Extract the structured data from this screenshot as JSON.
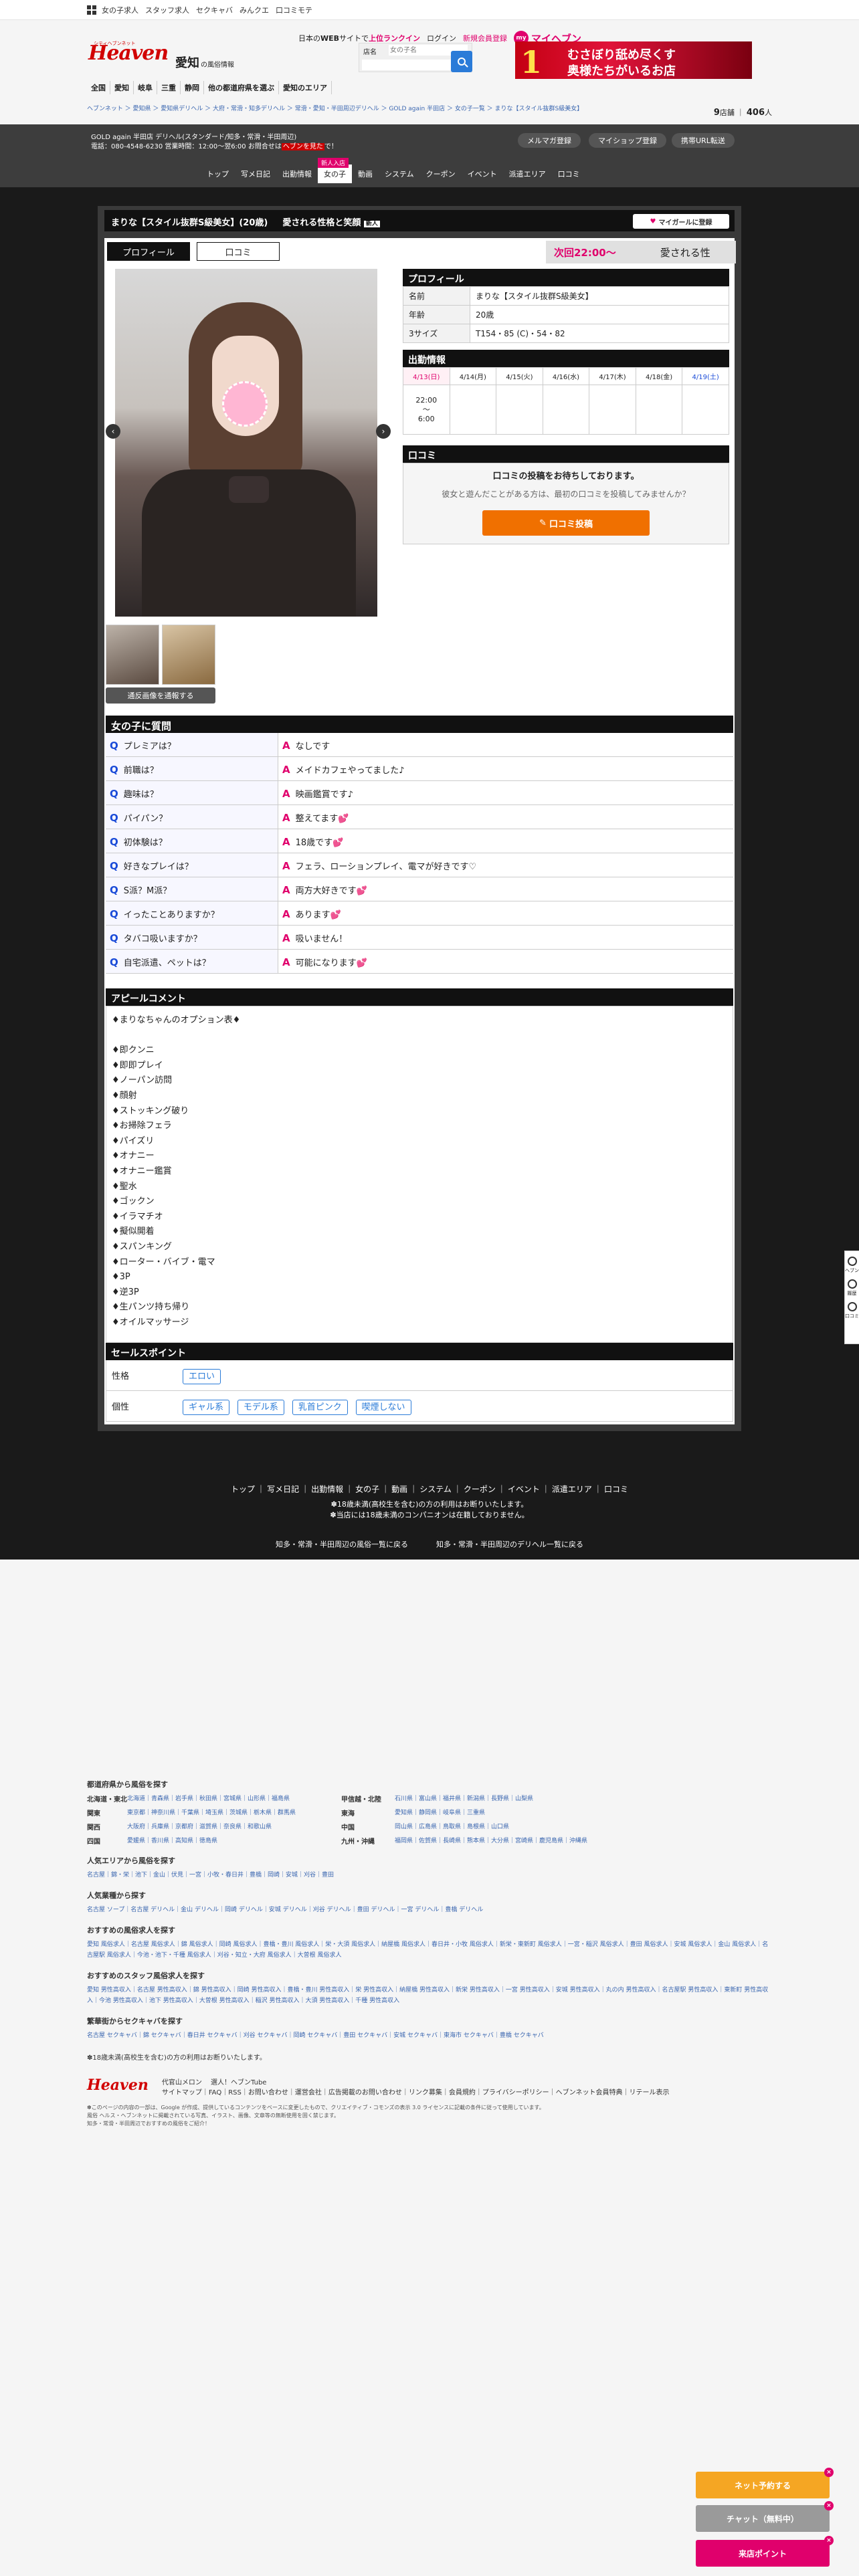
{
  "topbar": {
    "links": [
      "女の子求人",
      "スタッフ求人",
      "セクキャバ",
      "みんクエ",
      "口コミモテ"
    ],
    "right_pre": "日本の",
    "right_web": "WEB",
    "right_mid": "サイトで",
    "right_hl": "上位ランクイン",
    "login": "ログイン",
    "register": "新規会員登録",
    "my_badge": "my",
    "myheaven": "マイヘブン"
  },
  "header": {
    "logo_sub": "シティヘブンネット",
    "logo": "Heaven",
    "area": "愛知",
    "area_sub": "の風俗情報",
    "search_label": "店名",
    "search_placeholder": "女の子名",
    "banner_num": "1",
    "banner_l1": "むさぼり舐め尽くす",
    "banner_l2": "奥様たちがいるお店"
  },
  "nav": [
    "全国",
    "愛知",
    "岐阜",
    "三重",
    "静岡",
    "他の都道府県を選ぶ",
    "愛知のエリア"
  ],
  "breadcrumb": "ヘブンネット ＞ 愛知県 ＞ 愛知県デリヘル ＞ 大府・常滑・知多デリヘル ＞ 常滑・愛知・半田周辺デリヘル ＞ GOLD again 半田店 ＞ 女の子一覧 ＞ まりな【スタイル抜群S級美女】",
  "counts": {
    "a": "9",
    "a_unit": "店舗",
    "b": "406",
    "b_unit": "人"
  },
  "shop": {
    "name": "GOLD again 半田店 デリヘル(スタンダード/知多・常滑・半田周辺)",
    "tel": "電話：080-4548-6230 営業時間：12:00〜翌6:00 お問合せは",
    "tel_red": "ヘブンを見た",
    "tel_end": "で！",
    "btns": [
      "メルマガ登録",
      "マイショップ登録",
      "携帯URL転送"
    ],
    "tabs": [
      "トップ",
      "写メ日記",
      "出勤情報",
      "女の子",
      "動画",
      "システム",
      "クーポン",
      "イベント",
      "派遣エリア",
      "口コミ"
    ],
    "new_badge": "新人入店"
  },
  "girl": {
    "title": "まりな【スタイル抜群S級美女】(20歳)",
    "catch": "愛される性格と笑顔",
    "new": "新人",
    "mypage": "マイガールに登録",
    "tabs": [
      "プロフィール",
      "口コミ"
    ],
    "next_work": "次回22:00〜",
    "next_scroll": "愛される性"
  },
  "profile": {
    "heading": "プロフィール",
    "rows": [
      {
        "k": "名前",
        "v": "まりな【スタイル抜群S級美女】"
      },
      {
        "k": "年齢",
        "v": "20歳"
      },
      {
        "k": "3サイズ",
        "v": "T154・85 (C)・54・82"
      }
    ]
  },
  "schedule": {
    "heading": "出勤情報",
    "days": [
      "4/13(日)",
      "4/14(月)",
      "4/15(火)",
      "4/16(水)",
      "4/17(木)",
      "4/18(金)",
      "4/19(土)"
    ],
    "time_start": "22:00",
    "time_sep": "〜",
    "time_end": "6:00"
  },
  "review": {
    "heading": "口コミ",
    "t1": "口コミの投稿をお待ちしております。",
    "t2": "彼女と遊んだことがある方は、最初の口コミを投稿してみませんか？",
    "btn": "口コミ投稿"
  },
  "photo": {
    "swap": "通反画像を通報する",
    "prev": "‹",
    "next": "›"
  },
  "qa": {
    "heading": "女の子に質問",
    "q_mark": "Q",
    "a_mark": "A",
    "items": [
      {
        "q": "プレミアは？",
        "a": "なしです"
      },
      {
        "q": "前職は？",
        "a": "メイドカフェやってました♪"
      },
      {
        "q": "趣味は？",
        "a": "映画鑑賞です♪"
      },
      {
        "q": "パイパン？",
        "a": "整えてます💕"
      },
      {
        "q": "初体験は？",
        "a": "18歳です💕"
      },
      {
        "q": "好きなプレイは？",
        "a": "フェラ、ローションプレイ、電マが好きです♡"
      },
      {
        "q": "S派？M派？",
        "a": "両方大好きです💕"
      },
      {
        "q": "イったことありますか？",
        "a": "あります💕"
      },
      {
        "q": "タバコ吸いますか？",
        "a": "吸いません！"
      },
      {
        "q": "自宅派遣、ペットは？",
        "a": "可能になります💕"
      }
    ]
  },
  "appeal": {
    "heading": "アピールコメント",
    "lines": [
      "♦まりなちゃんのオプション表♦",
      "",
      "♦即クンニ",
      "♦即即プレイ",
      "♦ノーパン訪問",
      "♦顔射",
      "♦ストッキング破り",
      "♦お掃除フェラ",
      "♦パイズリ",
      "♦オナニー",
      "♦オナニー鑑賞",
      "♦聖水",
      "♦ゴックン",
      "♦イラマチオ",
      "♦擬似開着",
      "♦スパンキング",
      "♦ローター・バイブ・電マ",
      "♦3P",
      "♦逆3P",
      "♦生パンツ持ち帰り",
      "♦オイルマッサージ"
    ]
  },
  "sales": {
    "heading": "セールスポイント",
    "k1": "性格",
    "v1": [
      "エロい"
    ],
    "k2": "個性",
    "v2": [
      "ギャル系",
      "モデル系",
      "乳首ピンク",
      "喫煙しない"
    ]
  },
  "footnav": {
    "links": [
      "トップ",
      "写メ日記",
      "出勤情報",
      "女の子",
      "動画",
      "システム",
      "クーポン",
      "イベント",
      "派遣エリア",
      "口コミ"
    ],
    "n1": "✽18歳未満(高校生を含む)の方の利用はお断りいたします。",
    "n2": "✽当店には18歳未満のコンパニオンは在籍しておりません。",
    "b1": "知多・常滑・半田周辺の風俗一覧に戻る",
    "b2": "知多・常滑・半田周辺のデリヘル一覧に戻る"
  },
  "bottom": {
    "h1": "都道府県から風俗を探す",
    "regions": [
      {
        "r": "北海道・東北",
        "p": "北海道｜青森県｜岩手県｜秋田県｜宮城県｜山形県｜福島県"
      },
      {
        "r": "甲信越・北陸",
        "p": "石川県｜富山県｜福井県｜新潟県｜長野県｜山梨県"
      },
      {
        "r": "関東",
        "p": "東京都｜神奈川県｜千葉県｜埼玉県｜茨城県｜栃木県｜群馬県"
      },
      {
        "r": "東海",
        "p": "愛知県｜静岡県｜岐阜県｜三重県"
      },
      {
        "r": "関西",
        "p": "大阪府｜兵庫県｜京都府｜滋賀県｜奈良県｜和歌山県"
      },
      {
        "r": "中国",
        "p": "岡山県｜広島県｜鳥取県｜島根県｜山口県"
      },
      {
        "r": "四国",
        "p": "愛媛県｜香川県｜高知県｜徳島県"
      },
      {
        "r": "九州・沖縄",
        "p": "福岡県｜佐賀県｜長崎県｜熊本県｜大分県｜宮崎県｜鹿児島県｜沖縄県"
      }
    ],
    "h2": "人気エリアから風俗を探す",
    "p2": "名古屋｜錦・栄｜池下｜金山｜伏見｜一宮｜小牧・春日井｜豊橋｜岡崎｜安城｜刈谷｜豊田",
    "h3": "人気業種から探す",
    "p3": "名古屋 ソープ｜名古屋 デリヘル｜金山 デリヘル｜岡崎 デリヘル｜安城 デリヘル｜刈谷 デリヘル｜豊田 デリヘル｜一宮 デリヘル｜豊橋 デリヘル",
    "h4": "おすすめの風俗求人を探す",
    "p4": "愛知 風俗求人｜名古屋 風俗求人｜錦 風俗求人｜岡崎 風俗求人｜豊橋・豊川 風俗求人｜栄・大須 風俗求人｜納屋橋 風俗求人｜春日井・小牧 風俗求人｜新栄・東新町 風俗求人｜一宮・稲沢 風俗求人｜豊田 風俗求人｜安城 風俗求人｜金山 風俗求人｜名古屋駅 風俗求人｜今池・池下・千種 風俗求人｜刈谷・知立・大府 風俗求人｜大曽根 風俗求人",
    "h5": "おすすめのスタッフ風俗求人を探す",
    "p5": "愛知 男性高収入｜名古屋 男性高収入｜錦 男性高収入｜岡崎 男性高収入｜豊橋・豊川 男性高収入｜栄 男性高収入｜納屋橋 男性高収入｜新栄 男性高収入｜一宮 男性高収入｜安城 男性高収入｜丸の内 男性高収入｜名古屋駅 男性高収入｜東新町 男性高収入｜今池 男性高収入｜池下 男性高収入｜大曽根 男性高収入｜稲沢 男性高収入｜大須 男性高収入｜千種 男性高収入",
    "h6": "繁華街からセクキャバを探す",
    "p6": "名古屋 セクキャバ｜錦 セクキャバ｜春日井 セクキャバ｜刈谷 セクキャバ｜岡崎 セクキャバ｜豊田 セクキャバ｜安城 セクキャバ｜東海市 セクキャバ｜豊橋 セクキャバ",
    "note": "✽18歳未満(高校生を含む)の方の利用はお断りいたします。",
    "partner1": "代官山メロン",
    "partner2": "選人！ヘブンTube",
    "flinks": "サイトマップ｜FAQ｜RSS｜お問い合わせ｜運営会社｜広告掲載のお問い合わせ｜リンク募集｜会員規約｜プライバシーポリシー｜ヘブンネット会員特典｜リテール表示",
    "copy1": "✽このページの内容の一部は、Google が作成、提供しているコンテンツをベースに変更したもので、クリエイティブ・コモンズの表示 3.0 ライセンスに記載の条件に従って使用しています。",
    "copy2": "風俗 ヘルス・ヘブンネットに掲載されている写真、イラスト、画像、文章等の無断使用を固く禁じます。",
    "copy3": "知多・常滑・半田周辺でおすすめの風俗をご紹介！"
  },
  "floats": {
    "f1": "ネット予約する",
    "f2": "チャット（無料中）",
    "f3": "来店ポイント",
    "close": "×"
  },
  "side": {
    "s1": "ヘブン",
    "s2": "履歴",
    "s3": "口コミ"
  },
  "colors": {
    "accent": "#e0006c",
    "dark": "#1a1a1a",
    "link": "#3a66b0"
  }
}
